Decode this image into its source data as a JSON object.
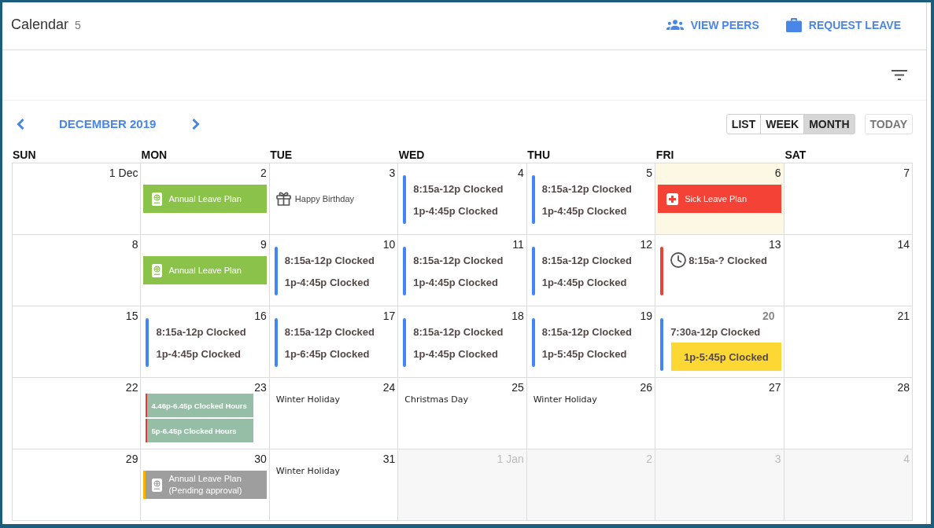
{
  "header": {
    "title": "Calendar",
    "count": "5",
    "actions": [
      {
        "kind": "peers",
        "label": "VIEW PEERS"
      },
      {
        "kind": "leave",
        "label": "REQUEST LEAVE"
      }
    ]
  },
  "month_nav": {
    "title": "DECEMBER 2019"
  },
  "view_switch": [
    {
      "label": "LIST",
      "selected": false
    },
    {
      "label": "WEEK",
      "selected": false
    },
    {
      "label": "MONTH",
      "selected": true
    }
  ],
  "today_button": {
    "label": "TODAY",
    "disabled": true
  },
  "weekdays": [
    "SUN",
    "MON",
    "TUE",
    "WED",
    "THU",
    "FRI",
    "SAT"
  ],
  "weeks": [
    [
      {
        "number": "1 Dec",
        "today": false,
        "other_month": false,
        "emphasized": false
      },
      {
        "number": "2",
        "today": false,
        "other_month": false,
        "emphasized": false,
        "events": [
          {
            "kind": "annual_leave",
            "label": "Annual Leave Plan",
            "color": "#8bc34a"
          }
        ]
      },
      {
        "number": "3",
        "today": false,
        "other_month": false,
        "emphasized": false,
        "events": [
          {
            "kind": "birthday",
            "label": "Happy Birthday"
          }
        ]
      },
      {
        "number": "4",
        "today": false,
        "other_month": false,
        "emphasized": false,
        "events": [
          {
            "kind": "clocked",
            "color": "#4285f4",
            "entries": [
              {
                "label": "8:15a-12p Clocked",
                "in_progress": false,
                "highlighted": false
              },
              {
                "label": "1p-4:45p Clocked",
                "in_progress": false,
                "highlighted": false
              }
            ]
          }
        ]
      },
      {
        "number": "5",
        "today": false,
        "other_month": false,
        "emphasized": false,
        "events": [
          {
            "kind": "clocked",
            "color": "#4285f4",
            "entries": [
              {
                "label": "8:15a-12p Clocked",
                "in_progress": false,
                "highlighted": false
              },
              {
                "label": "1p-4:45p Clocked",
                "in_progress": false,
                "highlighted": false
              }
            ]
          }
        ]
      },
      {
        "number": "6",
        "today": true,
        "other_month": false,
        "emphasized": false,
        "events": [
          {
            "kind": "sick_leave",
            "label": "Sick Leave Plan",
            "color": "#f44336"
          }
        ]
      },
      {
        "number": "7",
        "today": false,
        "other_month": false,
        "emphasized": false
      }
    ],
    [
      {
        "number": "8",
        "today": false,
        "other_month": false,
        "emphasized": false
      },
      {
        "number": "9",
        "today": false,
        "other_month": false,
        "emphasized": false,
        "events": [
          {
            "kind": "annual_leave",
            "label": "Annual Leave Plan",
            "color": "#8bc34a"
          }
        ]
      },
      {
        "number": "10",
        "today": false,
        "other_month": false,
        "emphasized": false,
        "events": [
          {
            "kind": "clocked",
            "color": "#4285f4",
            "entries": [
              {
                "label": "8:15a-12p Clocked",
                "in_progress": false,
                "highlighted": false
              },
              {
                "label": "1p-4:45p Clocked",
                "in_progress": false,
                "highlighted": false
              }
            ]
          }
        ]
      },
      {
        "number": "11",
        "today": false,
        "other_month": false,
        "emphasized": false,
        "events": [
          {
            "kind": "clocked",
            "color": "#4285f4",
            "entries": [
              {
                "label": "8:15a-12p Clocked",
                "in_progress": false,
                "highlighted": false
              },
              {
                "label": "1p-4:45p Clocked",
                "in_progress": false,
                "highlighted": false
              }
            ]
          }
        ]
      },
      {
        "number": "12",
        "today": false,
        "other_month": false,
        "emphasized": false,
        "events": [
          {
            "kind": "clocked",
            "color": "#4285f4",
            "entries": [
              {
                "label": "8:15a-12p Clocked",
                "in_progress": false,
                "highlighted": false
              },
              {
                "label": "1p-4:45p Clocked",
                "in_progress": false,
                "highlighted": false
              }
            ]
          }
        ]
      },
      {
        "number": "13",
        "today": false,
        "other_month": false,
        "emphasized": false,
        "events": [
          {
            "kind": "clocked",
            "color": "#ea4335",
            "entries": [
              {
                "label": "8:15a-? Clocked",
                "in_progress": true,
                "highlighted": false
              }
            ]
          }
        ]
      },
      {
        "number": "14",
        "today": false,
        "other_month": false,
        "emphasized": false
      }
    ],
    [
      {
        "number": "15",
        "today": false,
        "other_month": false,
        "emphasized": false
      },
      {
        "number": "16",
        "today": false,
        "other_month": false,
        "emphasized": false,
        "events": [
          {
            "kind": "clocked",
            "color": "#4285f4",
            "entries": [
              {
                "label": "8:15a-12p Clocked",
                "in_progress": false,
                "highlighted": false
              },
              {
                "label": "1p-4:45p Clocked",
                "in_progress": false,
                "highlighted": false
              }
            ]
          }
        ]
      },
      {
        "number": "17",
        "today": false,
        "other_month": false,
        "emphasized": false,
        "events": [
          {
            "kind": "clocked",
            "color": "#4285f4",
            "entries": [
              {
                "label": "8:15a-12p Clocked",
                "in_progress": false,
                "highlighted": false
              },
              {
                "label": "1p-6:45p Clocked",
                "in_progress": false,
                "highlighted": false
              }
            ]
          }
        ]
      },
      {
        "number": "18",
        "today": false,
        "other_month": false,
        "emphasized": false,
        "events": [
          {
            "kind": "clocked",
            "color": "#4285f4",
            "entries": [
              {
                "label": "8:15a-12p Clocked",
                "in_progress": false,
                "highlighted": false
              },
              {
                "label": "1p-4:45p Clocked",
                "in_progress": false,
                "highlighted": false
              }
            ]
          }
        ]
      },
      {
        "number": "19",
        "today": false,
        "other_month": false,
        "emphasized": false,
        "events": [
          {
            "kind": "clocked",
            "color": "#4285f4",
            "entries": [
              {
                "label": "8:15a-12p Clocked",
                "in_progress": false,
                "highlighted": false
              },
              {
                "label": "1p-5:45p Clocked",
                "in_progress": false,
                "highlighted": false
              }
            ]
          }
        ]
      },
      {
        "number": "20",
        "today": false,
        "other_month": false,
        "emphasized": true,
        "events": [
          {
            "kind": "clocked",
            "color": "#4285f4",
            "entries": [
              {
                "label": "7:30a-12p Clocked",
                "in_progress": false,
                "highlighted": false
              },
              {
                "label": "1p-5:45p Clocked",
                "in_progress": false,
                "highlighted": true
              }
            ]
          }
        ]
      },
      {
        "number": "21",
        "today": false,
        "other_month": false,
        "emphasized": false
      }
    ],
    [
      {
        "number": "22",
        "today": false,
        "other_month": false,
        "emphasized": false
      },
      {
        "number": "23",
        "today": false,
        "other_month": false,
        "emphasized": false,
        "events": [
          {
            "kind": "hours",
            "label": "4.46p-6.45p Clocked Hours",
            "color": "#96bea6"
          },
          {
            "kind": "hours",
            "label": "5p-6.45p Clocked Hours",
            "color": "#96bea6"
          }
        ]
      },
      {
        "number": "24",
        "today": false,
        "other_month": false,
        "emphasized": false,
        "events": [
          {
            "kind": "holiday",
            "label": "Winter Holiday"
          }
        ]
      },
      {
        "number": "25",
        "today": false,
        "other_month": false,
        "emphasized": false,
        "events": [
          {
            "kind": "holiday",
            "label": "Christmas Day"
          }
        ]
      },
      {
        "number": "26",
        "today": false,
        "other_month": false,
        "emphasized": false,
        "events": [
          {
            "kind": "holiday",
            "label": "Winter Holiday"
          }
        ]
      },
      {
        "number": "27",
        "today": false,
        "other_month": false,
        "emphasized": false
      },
      {
        "number": "28",
        "today": false,
        "other_month": false,
        "emphasized": false
      }
    ],
    [
      {
        "number": "29",
        "today": false,
        "other_month": false,
        "emphasized": false
      },
      {
        "number": "30",
        "today": false,
        "other_month": false,
        "emphasized": false,
        "events": [
          {
            "kind": "pending_leave",
            "label": "Annual Leave Plan",
            "status": "(Pending approval)",
            "color": "#9e9e9e"
          }
        ]
      },
      {
        "number": "31",
        "today": false,
        "other_month": false,
        "emphasized": false,
        "events": [
          {
            "kind": "holiday",
            "label": "Winter Holiday"
          }
        ]
      },
      {
        "number": "1 Jan",
        "today": false,
        "other_month": true,
        "emphasized": false
      },
      {
        "number": "2",
        "today": false,
        "other_month": true,
        "emphasized": false
      },
      {
        "number": "3",
        "today": false,
        "other_month": true,
        "emphasized": false
      },
      {
        "number": "4",
        "today": false,
        "other_month": true,
        "emphasized": false
      }
    ]
  ]
}
